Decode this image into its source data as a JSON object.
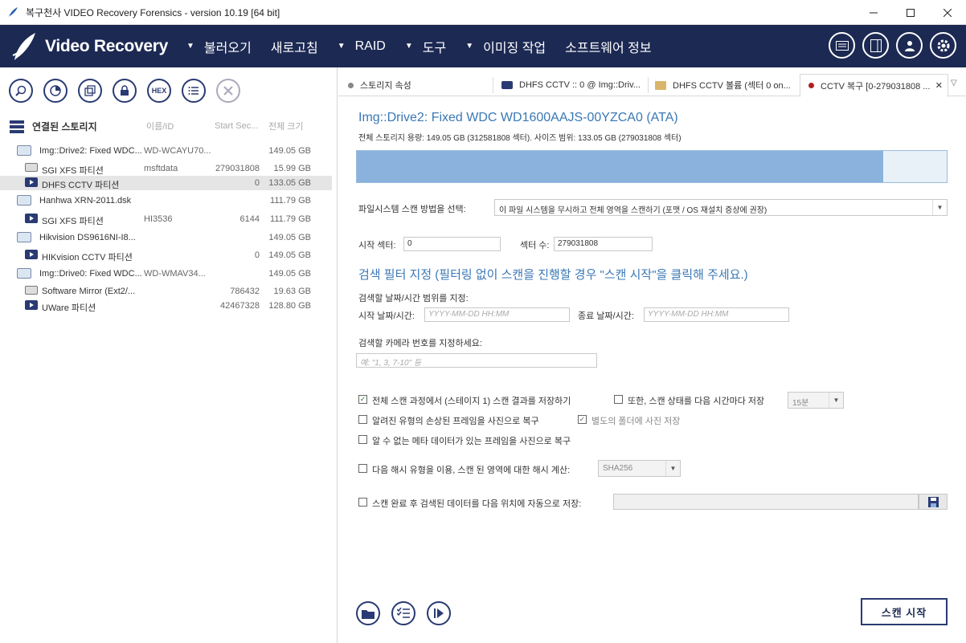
{
  "window": {
    "title": "복구천사 VIDEO Recovery Forensics - version 10.19 [64 bit]",
    "controls": [
      "minimize-icon",
      "maximize-icon",
      "close-icon"
    ]
  },
  "navbar": {
    "brand": "Video Recovery",
    "menu": [
      {
        "label": "불러오기",
        "has_caret": true
      },
      {
        "label": "새로고침",
        "has_caret": false
      },
      {
        "label": "RAID",
        "has_caret": true
      },
      {
        "label": "도구",
        "has_caret": true
      },
      {
        "label": "이미징 작업",
        "has_caret": true
      },
      {
        "label": "소프트웨어 정보",
        "has_caret": false
      }
    ],
    "icons": [
      "message-icon",
      "panel-icon",
      "user-icon",
      "settings-icon"
    ],
    "bg_color": "#1c2953"
  },
  "left": {
    "toolbar": [
      {
        "name": "search-icon",
        "label": ""
      },
      {
        "name": "analyze-icon",
        "label": ""
      },
      {
        "name": "copy-icon",
        "label": ""
      },
      {
        "name": "lock-icon",
        "label": ""
      },
      {
        "name": "hex-icon",
        "label": "HEX"
      },
      {
        "name": "list-icon",
        "label": ""
      },
      {
        "name": "close-icon",
        "label": ""
      }
    ],
    "tree_header": {
      "title": "연결된 스토리지",
      "col_name": "이름/ID",
      "col_start": "Start Sec...",
      "col_size": "전체 크기"
    },
    "rows": [
      {
        "type": "disk",
        "label": "Img::Drive2: Fixed WDC...",
        "id": "WD-WCAYU70...",
        "start": "",
        "size": "149.05 GB"
      },
      {
        "type": "hdd",
        "label": "SGI XFS 파티션",
        "id": "msftdata",
        "start": "279031808",
        "size": "15.99 GB"
      },
      {
        "type": "vid",
        "label": "DHFS CCTV 파티션",
        "id": "",
        "start": "0",
        "size": "133.05 GB",
        "selected": true
      },
      {
        "type": "disk",
        "label": "Hanhwa XRN-2011.dsk",
        "id": "",
        "start": "",
        "size": "111.79 GB"
      },
      {
        "type": "vid",
        "label": "SGI XFS 파티션",
        "id": "HI3536",
        "start": "6144",
        "size": "111.79 GB"
      },
      {
        "type": "disk",
        "label": "Hikvision DS9616NI-I8...",
        "id": "",
        "start": "",
        "size": "149.05 GB"
      },
      {
        "type": "vid",
        "label": "HIKvision CCTV 파티션",
        "id": "",
        "start": "0",
        "size": "149.05 GB"
      },
      {
        "type": "disk",
        "label": "Img::Drive0: Fixed WDC...",
        "id": "WD-WMAV34...",
        "start": "",
        "size": "149.05 GB"
      },
      {
        "type": "hdd2",
        "label": "Software Mirror (Ext2/...",
        "id": "",
        "start": "786432",
        "size": "19.63 GB"
      },
      {
        "type": "vid",
        "label": "UWare 파티션",
        "id": "",
        "start": "42467328",
        "size": "128.80 GB"
      }
    ]
  },
  "tabs": [
    {
      "label": "스토리지 속성",
      "dot": "#888888"
    },
    {
      "label": "DHFS CCTV :: 0 @ Img::Driv...",
      "icon": "video"
    },
    {
      "label": "DHFS CCTV 볼륨 (섹터 0 on...",
      "icon": "folder"
    },
    {
      "label": "CCTV 복구 [0-279031808 ...",
      "dot": "#b02020",
      "active": true
    }
  ],
  "main": {
    "drive_title": "Img::Drive2: Fixed WDC WD1600AAJS-00YZCA0 (ATA)",
    "drive_info": "전체 스토리지 용량: 149.05 GB (312581808 섹터). 사이즈 범위: 133.05 GB (279031808 섹터)",
    "range_fraction": 0.893,
    "scan_method_label": "파일시스템 스캔 방법을 선택:",
    "scan_method_value": "이 파일 시스템을 무시하고 전체 영역을 스캔하기 (포맷 / OS 재설치 증상에 권장)",
    "start_sector_label": "시작 섹터:",
    "start_sector_value": "0",
    "sector_count_label": "섹터 수:",
    "sector_count_value": "279031808",
    "filter_title": "검색 필터 지정 (필터링 없이 스캔을 진행할 경우 \"스캔 시작\"을 클릭해 주세요.)",
    "date_range_label": "검색할 날짜/시간 범위를 지정:",
    "start_date_label": "시작 날짜/시간:",
    "start_date_placeholder": "YYYY-MM-DD HH:MM",
    "end_date_label": "종료 날짜/시간:",
    "end_date_placeholder": "YYYY-MM-DD HH:MM",
    "camera_label": "검색할 카메라 번호를 지정하세요:",
    "camera_placeholder": "예: \"1, 3, 7-10\" 등",
    "opt_save_stage1": "전체 스캔 과정에서 (스테이지 1) 스캔 결과를 저장하기",
    "opt_save_state": "또한, 스캔 상태를 다음 시간마다 저장",
    "opt_interval": "15분",
    "opt_damaged_frames": "알려진 유형의 손상된 프레임을 사진으로 복구",
    "opt_separate_folder": "별도의 폴더에 사진 저장",
    "opt_unknown_meta": "알 수 없는 메타 데이터가 있는 프레임을 사진으로 복구",
    "opt_hash": "다음 해시 유형을 이용, 스캔 된 영역에 대한 해시 계산:",
    "opt_hash_value": "SHA256",
    "opt_autosave": "스캔 완료 후 검색된 데이터를 다음 위치에 자동으로 저장:",
    "opt_autosave_path": "",
    "scan_button": "스캔 시작",
    "bottom_icons": [
      "folder-icon",
      "checklist-icon",
      "play-icon"
    ]
  }
}
